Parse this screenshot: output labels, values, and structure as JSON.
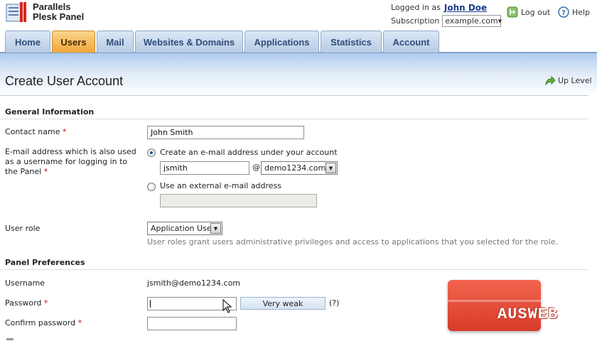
{
  "brand": {
    "line1": "Parallels",
    "line2": "Plesk Panel"
  },
  "account": {
    "logged_in_label": "Logged in as",
    "user_name": "John Doe",
    "subscription_label": "Subscription",
    "subscription_value": "example.com",
    "logout_label": "Log out",
    "help_label": "Help"
  },
  "tabs": [
    {
      "label": "Home"
    },
    {
      "label": "Users",
      "active": true
    },
    {
      "label": "Mail"
    },
    {
      "label": "Websites & Domains"
    },
    {
      "label": "Applications"
    },
    {
      "label": "Statistics"
    },
    {
      "label": "Account"
    }
  ],
  "page": {
    "title": "Create User Account",
    "up_level_label": "Up Level"
  },
  "general": {
    "section_title": "General Information",
    "contact_name_label": "Contact name",
    "contact_name_value": "John Smith",
    "email_label": "E-mail address which is also used as a username for logging in to the Panel",
    "option_create_label": "Create an e-mail address under your account",
    "email_local_value": "jsmith",
    "at_sign": "@",
    "email_domain_value": "demo1234.com",
    "option_external_label": "Use an external e-mail address",
    "external_value": "",
    "user_role_label": "User role",
    "user_role_value": "Application User",
    "user_role_hint": "User roles grant users administrative privileges and access to applications that you selected for the role."
  },
  "prefs": {
    "section_title": "Panel Preferences",
    "username_label": "Username",
    "username_value": "jsmith@demo1234.com",
    "password_label": "Password",
    "password_value": "",
    "strength_label": "Very weak",
    "strength_help": "(?)",
    "confirm_label": "Confirm password",
    "confirm_value": ""
  },
  "required_mark": "*",
  "watermark": {
    "text": "AUSWEB"
  },
  "colors": {
    "active_tab": "#f1a63a",
    "tab": "#b7cbe4",
    "required": "#dd0000",
    "watermark": "#e04a36"
  }
}
